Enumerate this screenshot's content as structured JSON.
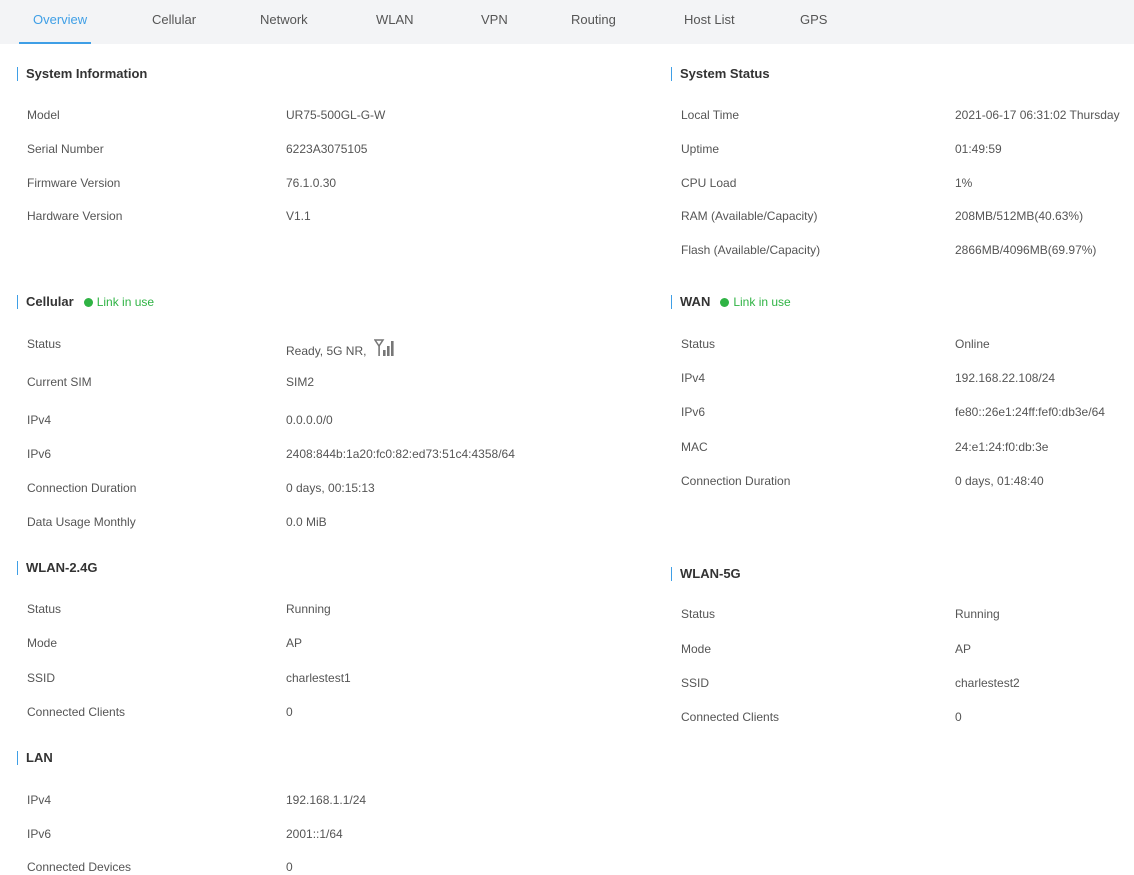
{
  "tabs": [
    "Overview",
    "Cellular",
    "Network",
    "WLAN",
    "VPN",
    "Routing",
    "Host List",
    "GPS"
  ],
  "colors": {
    "accent": "#3f9fe6",
    "link_ok": "#2fb344",
    "tab_bg": "#f3f4f6"
  },
  "system_info": {
    "title": "System Information",
    "rows": [
      {
        "label": "Model",
        "value": "UR75-500GL-G-W"
      },
      {
        "label": "Serial Number",
        "value": "6223A3075105"
      },
      {
        "label": "Firmware Version",
        "value": "76.1.0.30"
      },
      {
        "label": "Hardware Version",
        "value": "V1.1"
      }
    ]
  },
  "system_status": {
    "title": "System Status",
    "rows": [
      {
        "label": "Local Time",
        "value": "2021-06-17 06:31:02 Thursday"
      },
      {
        "label": "Uptime",
        "value": "01:49:59"
      },
      {
        "label": "CPU Load",
        "value": "1%"
      },
      {
        "label": "RAM (Available/Capacity)",
        "value": "208MB/512MB(40.63%)"
      },
      {
        "label": "Flash (Available/Capacity)",
        "value": "2866MB/4096MB(69.97%)"
      }
    ]
  },
  "cellular": {
    "title": "Cellular",
    "link_status": "Link in use",
    "signal_icon": "signal-strength-icon",
    "rows": [
      {
        "label": "Status",
        "value": "Ready, 5G NR,"
      },
      {
        "label": "Current SIM",
        "value": "SIM2"
      },
      {
        "label": "IPv4",
        "value": "0.0.0.0/0"
      },
      {
        "label": "IPv6",
        "value": "2408:844b:1a20:fc0:82:ed73:51c4:4358/64"
      },
      {
        "label": "Connection Duration",
        "value": "0 days, 00:15:13"
      },
      {
        "label": "Data Usage Monthly",
        "value": "0.0 MiB"
      }
    ]
  },
  "wan": {
    "title": "WAN",
    "link_status": "Link in use",
    "rows": [
      {
        "label": "Status",
        "value": "Online"
      },
      {
        "label": "IPv4",
        "value": "192.168.22.108/24"
      },
      {
        "label": "IPv6",
        "value": "fe80::26e1:24ff:fef0:db3e/64"
      },
      {
        "label": "MAC",
        "value": "24:e1:24:f0:db:3e"
      },
      {
        "label": "Connection Duration",
        "value": "0 days, 01:48:40"
      }
    ]
  },
  "wlan24": {
    "title": "WLAN-2.4G",
    "rows": [
      {
        "label": "Status",
        "value": "Running"
      },
      {
        "label": "Mode",
        "value": "AP"
      },
      {
        "label": "SSID",
        "value": "charlestest1"
      },
      {
        "label": "Connected Clients",
        "value": "0"
      }
    ]
  },
  "wlan5": {
    "title": "WLAN-5G",
    "rows": [
      {
        "label": "Status",
        "value": "Running"
      },
      {
        "label": "Mode",
        "value": "AP"
      },
      {
        "label": "SSID",
        "value": "charlestest2"
      },
      {
        "label": "Connected Clients",
        "value": "0"
      }
    ]
  },
  "lan": {
    "title": "LAN",
    "rows": [
      {
        "label": "IPv4",
        "value": "192.168.1.1/24"
      },
      {
        "label": "IPv6",
        "value": "2001::1/64"
      },
      {
        "label": "Connected Devices",
        "value": "0"
      }
    ]
  }
}
